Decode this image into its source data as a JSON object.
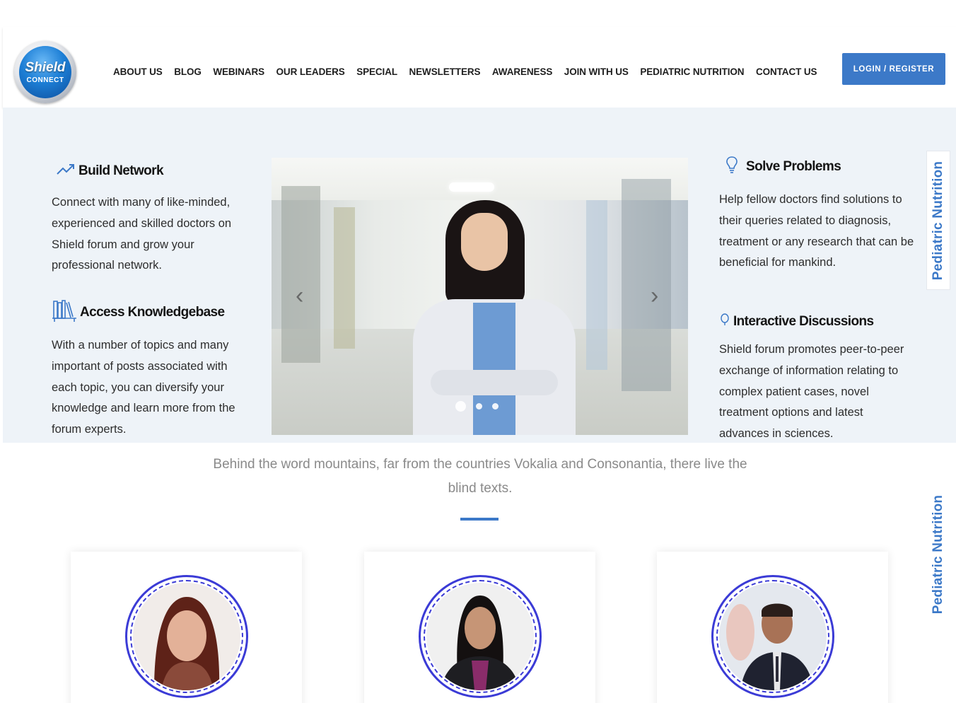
{
  "logo": {
    "line1": "Shield",
    "line2": "CONNECT"
  },
  "nav": [
    "ABOUT US",
    "BLOG",
    "WEBINARS",
    "OUR LEADERS",
    "SPECIAL",
    "NEWSLETTERS",
    "AWARENESS",
    "JOIN WITH US",
    "PEDIATRIC NUTRITION",
    "CONTACT US"
  ],
  "login_label": "LOGIN / REGISTER",
  "features": {
    "build_network": {
      "title": "Build Network",
      "desc": "Connect with many of like-minded, experienced and skilled doctors on Shield forum and grow your professional network."
    },
    "access_kb": {
      "title": "Access Knowledgebase",
      "desc": "With a number of topics and many important of posts associated with each topic, you can diversify your knowledge and learn more from the forum experts."
    },
    "solve_problems": {
      "title": "Solve Problems",
      "desc": "Help fellow doctors find solutions to their queries related to diagnosis, treatment or any research that can be beneficial for mankind."
    },
    "interactive": {
      "title": "Interactive Discussions",
      "desc": "Shield forum promotes peer-to-peer exchange of information relating to complex patient cases, novel treatment options and latest advances in sciences."
    }
  },
  "slider": {
    "prev": "‹",
    "next": "›",
    "slide_count": 3,
    "active_slide": 1
  },
  "side_tab": "Pediatric Nutrition",
  "tagline": "Behind the word mountains, far from the countries Vokalia and Consonantia, there live the blind texts.",
  "cards": [
    {
      "photo": "leader-photo-1"
    },
    {
      "photo": "leader-photo-2"
    },
    {
      "photo": "leader-photo-3"
    }
  ],
  "colors": {
    "accent": "#3c79c8",
    "hero_bg": "#eef3f8",
    "ring": "#3b3bd6"
  }
}
